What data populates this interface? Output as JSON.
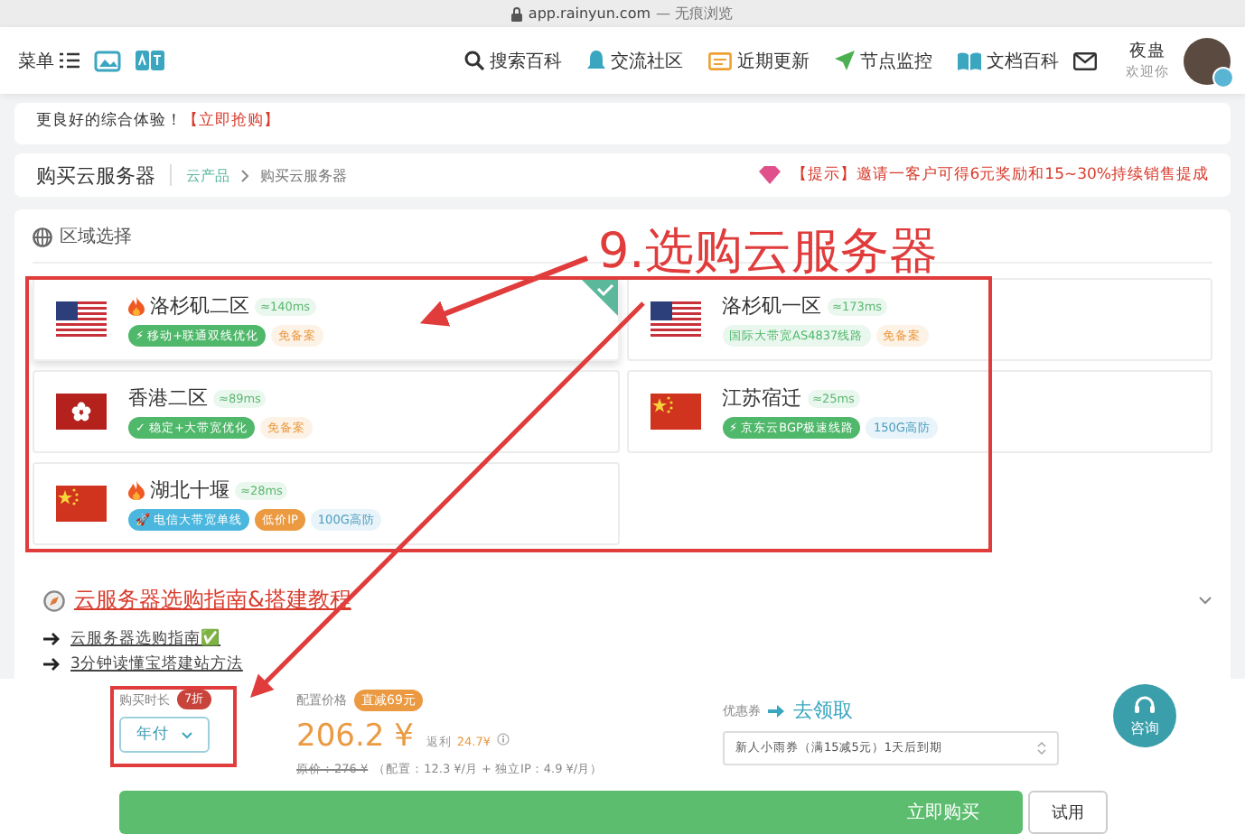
{
  "browser": {
    "address": "app.rainyun.com",
    "mode": "— 无痕浏览"
  },
  "nav": {
    "menu": "菜单",
    "links": [
      {
        "label": "搜索百科",
        "kind": "search"
      },
      {
        "label": "交流社区",
        "kind": "bell"
      },
      {
        "label": "近期更新",
        "kind": "card"
      },
      {
        "label": "节点监控",
        "kind": "send"
      },
      {
        "label": "文档百科",
        "kind": "book"
      }
    ],
    "user": {
      "name": "夜蛊",
      "greeting": "欢迎你"
    }
  },
  "promo": {
    "text": "更良好的综合体验！",
    "link": "【立即抢购】"
  },
  "header": {
    "title": "购买云服务器",
    "breadcrumb": [
      "云产品",
      "购买云服务器"
    ],
    "tip": "【提示】邀请一客户可得6元奖励和15~30%持续销售提成"
  },
  "region_section": {
    "title": "区域选择",
    "regions": [
      {
        "name": "洛杉矶二区",
        "hot": true,
        "latency": "≈140ms",
        "kind": "us",
        "selected": true,
        "tags": [
          {
            "text": "⚡ 移动+联通双线优化",
            "kind": "solid-green"
          },
          {
            "text": "免备案",
            "kind": "soft-orange"
          }
        ]
      },
      {
        "name": "洛杉矶一区",
        "hot": false,
        "latency": "≈173ms",
        "kind": "us",
        "selected": false,
        "tags": [
          {
            "text": "国际大带宽AS4837线路",
            "kind": "soft-green"
          },
          {
            "text": "免备案",
            "kind": "soft-orange"
          }
        ]
      },
      {
        "name": "香港二区",
        "hot": false,
        "latency": "≈89ms",
        "kind": "hk",
        "selected": false,
        "tags": [
          {
            "text": "✓ 稳定+大带宽优化",
            "kind": "solid-green"
          },
          {
            "text": "免备案",
            "kind": "soft-orange"
          }
        ]
      },
      {
        "name": "江苏宿迁",
        "hot": false,
        "latency": "≈25ms",
        "kind": "cn",
        "selected": false,
        "tags": [
          {
            "text": "⚡ 京东云BGP极速线路",
            "kind": "solid-green"
          },
          {
            "text": "150G高防",
            "kind": "soft-blue"
          }
        ]
      },
      {
        "name": "湖北十堰",
        "hot": true,
        "latency": "≈28ms",
        "kind": "cn",
        "selected": false,
        "tags": [
          {
            "text": "🚀 电信大带宽单线",
            "kind": "solid-blue"
          },
          {
            "text": "低价IP",
            "kind": "solid-orange"
          },
          {
            "text": "100G高防",
            "kind": "soft-blue"
          }
        ]
      }
    ]
  },
  "guide": {
    "title": "云服务器选购指南&搭建教程",
    "items": [
      "云服务器选购指南✅",
      "3分钟读懂宝塔建站方法"
    ]
  },
  "order": {
    "duration_label": "购买时长",
    "duration_badge": "7折",
    "duration": "年付",
    "price_label": "配置价格",
    "price_badge": "直减69元",
    "price": "206.2 ¥",
    "rebate_label": "返利",
    "rebate": "24.7¥",
    "original": "原价：276 ¥",
    "breakdown": "（配置：12.3 ¥/月 + 独立IP：4.9 ¥/月）",
    "coupon_label": "优惠券",
    "coupon_link": "去领取",
    "coupon": "新人小雨券（满15减5元）1天后到期",
    "consult": "咨询",
    "buy": "立即购买",
    "trial": "试用"
  },
  "annotation": {
    "text": "9.选购云服务器"
  }
}
